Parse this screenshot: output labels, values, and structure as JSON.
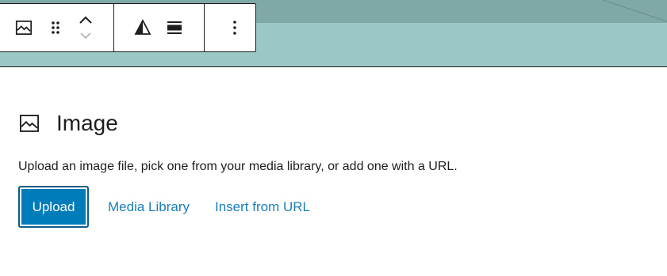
{
  "colors": {
    "banner_dark": "#7fa8a6",
    "banner_light": "#9cc7c7",
    "primary_button": "#007cba",
    "link": "#1a7fb8",
    "text": "#1e1e1e"
  },
  "toolbar": {
    "groups": [
      {
        "items": [
          {
            "icon": "image-icon",
            "label": "Image"
          },
          {
            "icon": "drag-handle-icon",
            "label": "Drag"
          },
          {
            "icon": "chevron-up-icon",
            "label": "Move up"
          },
          {
            "icon": "chevron-down-icon",
            "label": "Move down"
          }
        ]
      },
      {
        "items": [
          {
            "icon": "duotone-icon",
            "label": "Apply duotone filter"
          },
          {
            "icon": "align-icon",
            "label": "Align"
          }
        ]
      },
      {
        "items": [
          {
            "icon": "more-options-icon",
            "label": "Options"
          }
        ]
      }
    ]
  },
  "placeholder": {
    "icon": "image-icon",
    "title": "Image",
    "instructions": "Upload an image file, pick one from your media library, or add one with a URL.",
    "upload_label": "Upload",
    "media_library_label": "Media Library",
    "insert_url_label": "Insert from URL"
  }
}
